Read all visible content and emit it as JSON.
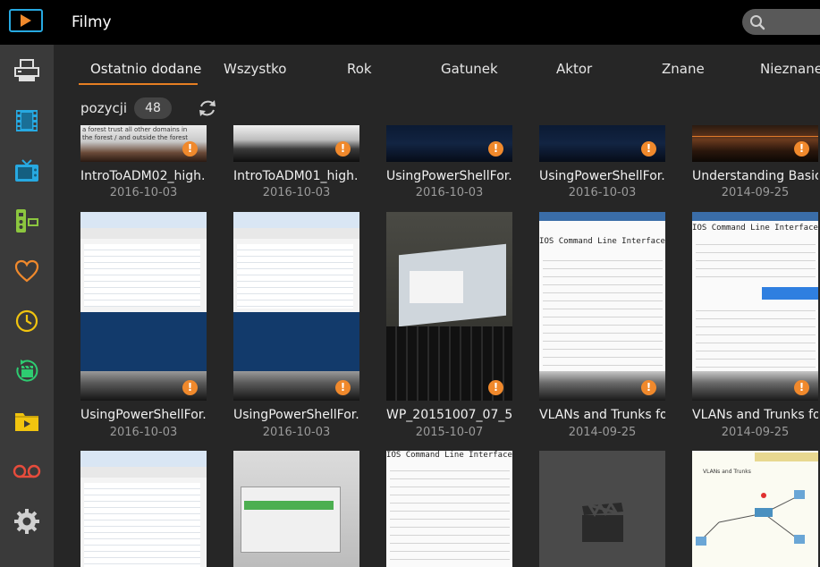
{
  "header": {
    "title": "Filmy"
  },
  "search": {
    "placeholder": ""
  },
  "sidebar": {
    "items": [
      {
        "name": "printer-icon",
        "color": "#e0e0e0"
      },
      {
        "name": "film-strip-icon",
        "color": "#27a9e1"
      },
      {
        "name": "tv-icon",
        "color": "#27a9e1"
      },
      {
        "name": "remote-control-icon",
        "color": "#8cc63f"
      },
      {
        "name": "heart-icon",
        "color": "#f0892c"
      },
      {
        "name": "clock-icon",
        "color": "#f1c40f"
      },
      {
        "name": "recent-clapper-icon",
        "color": "#2ecc71"
      },
      {
        "name": "folder-icon",
        "color": "#f1c40f"
      },
      {
        "name": "tape-icon",
        "color": "#e74c3c"
      },
      {
        "name": "gear-icon",
        "color": "#d0d0d0"
      }
    ]
  },
  "tabs": [
    {
      "label": "Ostatnio dodane",
      "active": true
    },
    {
      "label": "Wszystko"
    },
    {
      "label": "Rok"
    },
    {
      "label": "Gatunek"
    },
    {
      "label": "Aktor"
    },
    {
      "label": "Znane"
    },
    {
      "label": "Nieznane"
    }
  ],
  "count": {
    "label": "pozycji",
    "value": "48"
  },
  "accent": "#e67e22",
  "rows": [
    {
      "items": [
        {
          "title": "IntroToADM02_high....",
          "date": "2016-10-03",
          "thumb_text": "a forest trust all other domains in the forest / and outside the forest"
        },
        {
          "title": "IntroToADM01_high....",
          "date": "2016-10-03"
        },
        {
          "title": "UsingPowerShellFor...",
          "date": "2016-10-03"
        },
        {
          "title": "UsingPowerShellFor...",
          "date": "2016-10-03"
        },
        {
          "title": "Understanding Basic...",
          "date": "2014-09-25"
        }
      ]
    },
    {
      "items": [
        {
          "title": "UsingPowerShellFor...",
          "date": "2016-10-03"
        },
        {
          "title": "UsingPowerShellFor...",
          "date": "2016-10-03"
        },
        {
          "title": "WP_20151007_07_56...",
          "date": "2015-10-07"
        },
        {
          "title": "VLANs and Trunks fo...",
          "date": "2014-09-25",
          "thumb_text": "IOS Command Line Interface"
        },
        {
          "title": "VLANs and Trunks fo...",
          "date": "2014-09-25",
          "thumb_text": "IOS Command Line Interface"
        }
      ]
    },
    {
      "items": [
        {
          "title": "",
          "date": ""
        },
        {
          "title": "",
          "date": ""
        },
        {
          "title": "",
          "date": "",
          "thumb_text": "IOS Command Line Interface"
        },
        {
          "title": "",
          "date": ""
        },
        {
          "title": "",
          "date": "",
          "thumb_text": "VLANs and Trunks"
        }
      ]
    }
  ],
  "warn_glyph": "!"
}
